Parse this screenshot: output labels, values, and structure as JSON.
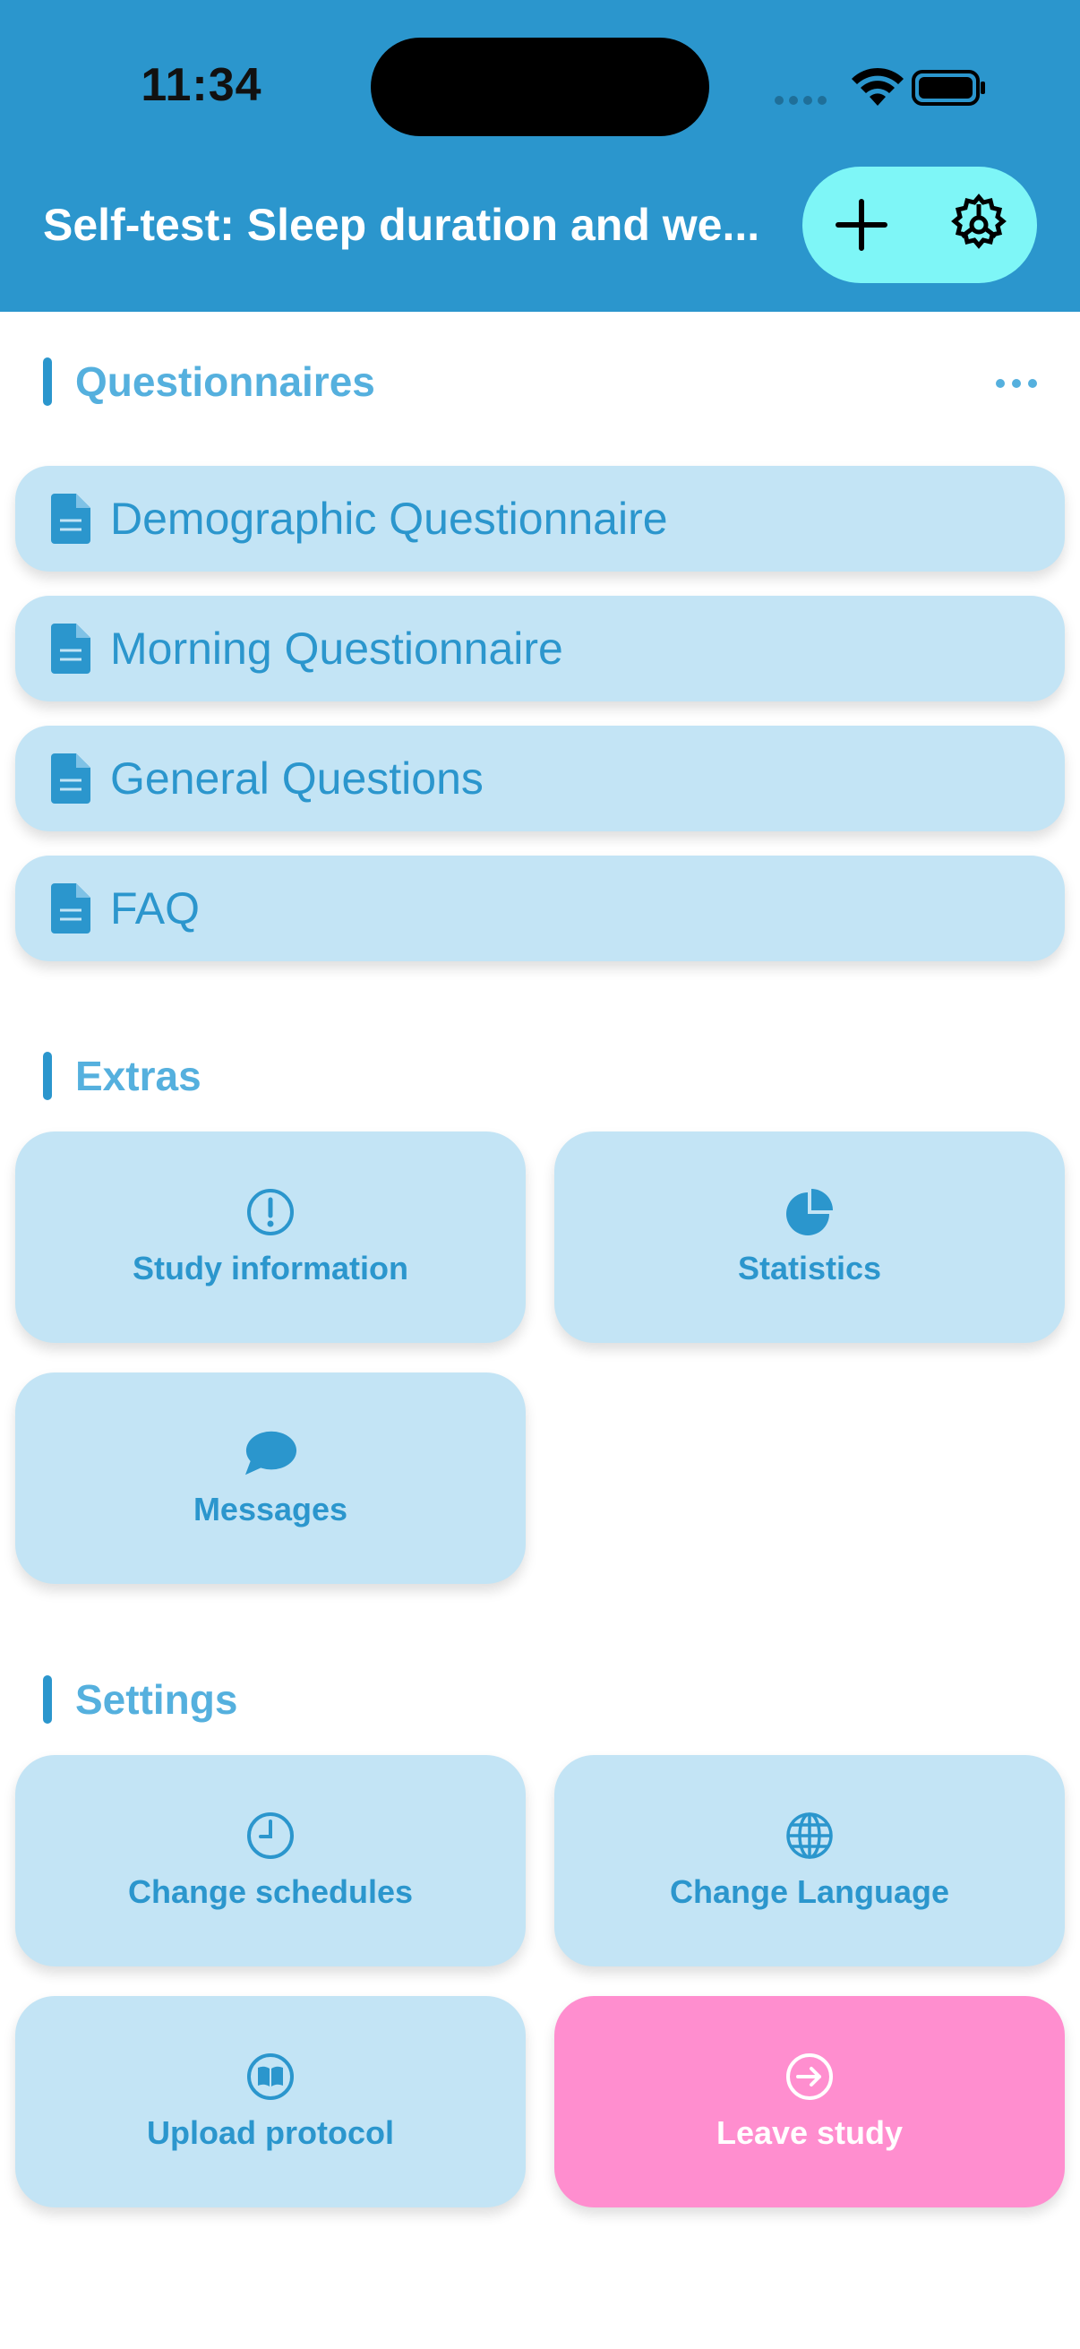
{
  "status_bar": {
    "time": "11:34"
  },
  "nav": {
    "title": "Self-test: Sleep duration and we..."
  },
  "sections": {
    "questionnaires": "Questionnaires",
    "extras": "Extras",
    "settings": "Settings"
  },
  "questionnaires": [
    {
      "label": "Demographic Questionnaire",
      "icon": "document-icon"
    },
    {
      "label": "Morning Questionnaire",
      "icon": "document-icon"
    },
    {
      "label": "General Questions",
      "icon": "document-icon"
    },
    {
      "label": "FAQ",
      "icon": "document-icon"
    }
  ],
  "extras": [
    {
      "label": "Study information",
      "icon": "info-icon"
    },
    {
      "label": "Statistics",
      "icon": "pie-chart-icon"
    },
    {
      "label": "Messages",
      "icon": "chat-bubble-icon"
    }
  ],
  "settings": [
    {
      "label": "Change schedules",
      "icon": "clock-icon"
    },
    {
      "label": "Change Language",
      "icon": "globe-icon"
    },
    {
      "label": "Upload protocol",
      "icon": "book-icon"
    },
    {
      "label": "Leave study",
      "icon": "exit-arrow-icon"
    }
  ],
  "colors": {
    "header": "#2b96cd",
    "accent": "#2b96cd",
    "card": "#c3e4f5",
    "nav_pill": "#7ef6f7",
    "danger": "#ff8ecf"
  }
}
